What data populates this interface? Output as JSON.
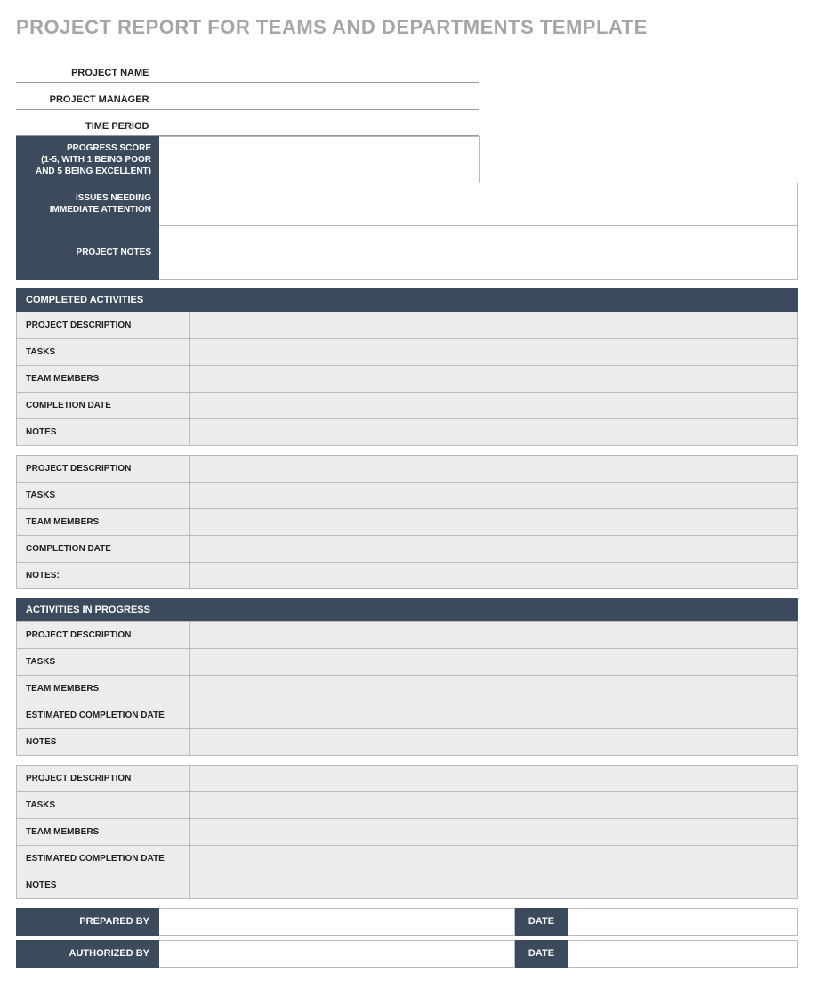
{
  "title": "PROJECT REPORT FOR TEAMS AND DEPARTMENTS TEMPLATE",
  "header": {
    "project_name_label": "PROJECT NAME",
    "project_name_value": "",
    "project_manager_label": "PROJECT MANAGER",
    "project_manager_value": "",
    "time_period_label": "TIME PERIOD",
    "time_period_value": ""
  },
  "summary": {
    "progress_score_label": "PROGRESS SCORE\n(1-5, WITH 1 BEING POOR AND 5 BEING EXCELLENT)",
    "progress_score_value": "",
    "issues_label": "ISSUES NEEDING IMMEDIATE ATTENTION",
    "issues_value": "",
    "notes_label": "PROJECT NOTES",
    "notes_value": ""
  },
  "sections": {
    "completed_banner": "COMPLETED ACTIVITIES",
    "in_progress_banner": "ACTIVITIES IN PROGRESS"
  },
  "completed": [
    {
      "project_description_label": "PROJECT DESCRIPTION",
      "project_description_value": "",
      "tasks_label": "TASKS",
      "tasks_value": "",
      "team_members_label": "TEAM MEMBERS",
      "team_members_value": "",
      "completion_date_label": "COMPLETION DATE",
      "completion_date_value": "",
      "notes_label": "NOTES",
      "notes_value": ""
    },
    {
      "project_description_label": "PROJECT DESCRIPTION",
      "project_description_value": "",
      "tasks_label": "TASKS",
      "tasks_value": "",
      "team_members_label": "TEAM MEMBERS",
      "team_members_value": "",
      "completion_date_label": "COMPLETION DATE",
      "completion_date_value": "",
      "notes_label": "NOTES:",
      "notes_value": ""
    }
  ],
  "in_progress": [
    {
      "project_description_label": "PROJECT DESCRIPTION",
      "project_description_value": "",
      "tasks_label": "TASKS",
      "tasks_value": "",
      "team_members_label": "TEAM MEMBERS",
      "team_members_value": "",
      "estimated_completion_date_label": "ESTIMATED COMPLETION DATE",
      "estimated_completion_date_value": "",
      "notes_label": "NOTES",
      "notes_value": ""
    },
    {
      "project_description_label": "PROJECT DESCRIPTION",
      "project_description_value": "",
      "tasks_label": "TASKS",
      "tasks_value": "",
      "team_members_label": "TEAM MEMBERS",
      "team_members_value": "",
      "estimated_completion_date_label": "ESTIMATED COMPLETION DATE",
      "estimated_completion_date_value": "",
      "notes_label": "NOTES",
      "notes_value": ""
    }
  ],
  "signature": {
    "prepared_by_label": "PREPARED BY",
    "prepared_by_value": "",
    "prepared_date_label": "DATE",
    "prepared_date_value": "",
    "authorized_by_label": "AUTHORIZED BY",
    "authorized_by_value": "",
    "authorized_date_label": "DATE",
    "authorized_date_value": ""
  }
}
